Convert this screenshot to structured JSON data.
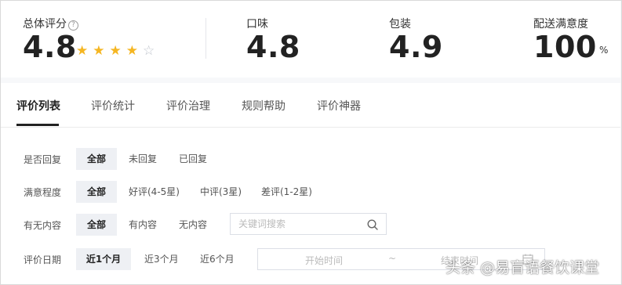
{
  "scores": {
    "overall": {
      "label": "总体评分",
      "value": "4.8",
      "rating": 4,
      "rating_max": 5,
      "help_glyph": "?"
    },
    "taste": {
      "label": "口味",
      "value": "4.8"
    },
    "packaging": {
      "label": "包装",
      "value": "4.9"
    },
    "delivery": {
      "label": "配送满意度",
      "value": "100",
      "unit": "%"
    }
  },
  "tabs": [
    {
      "label": "评价列表",
      "active": true
    },
    {
      "label": "评价统计"
    },
    {
      "label": "评价治理"
    },
    {
      "label": "规则帮助"
    },
    {
      "label": "评价神器"
    }
  ],
  "filters": {
    "reply_status": {
      "label": "是否回复",
      "options": [
        "全部",
        "未回复",
        "已回复"
      ],
      "selected": "全部"
    },
    "satisfaction": {
      "label": "满意程度",
      "options": [
        "全部",
        "好评(4-5星)",
        "中评(3星)",
        "差评(1-2星)"
      ],
      "selected": "全部"
    },
    "content": {
      "label": "有无内容",
      "options": [
        "全部",
        "有内容",
        "无内容"
      ],
      "selected": "全部",
      "search_placeholder": "关键词搜索"
    },
    "date": {
      "label": "评价日期",
      "options": [
        "近1个月",
        "近3个月",
        "近6个月"
      ],
      "selected": "近1个月",
      "start_placeholder": "开始时间",
      "separator": "~",
      "end_placeholder": "结束时间"
    }
  },
  "watermark": "头条 @易盲语餐饮课堂",
  "colors": {
    "star": "#f5b622",
    "star_empty": "#bfc4cc",
    "active_bg": "#eef0f4"
  }
}
